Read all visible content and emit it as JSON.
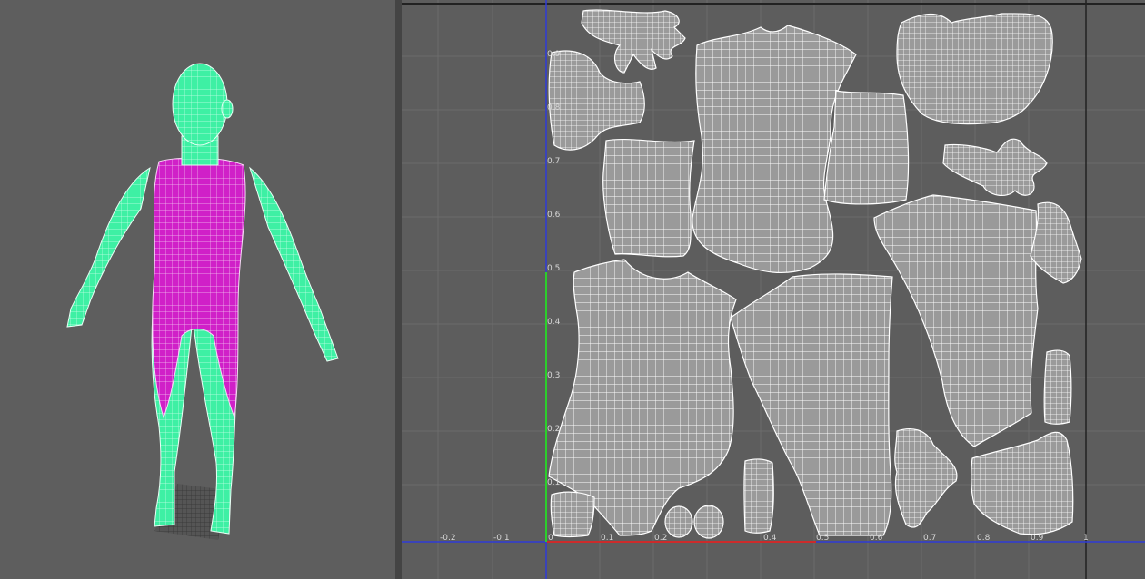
{
  "viewport": {
    "name": "3d-perspective-view",
    "mesh": "female-body-wireframe"
  },
  "uv_editor": {
    "name": "uv-texture-editor",
    "x_ticks": [
      "-0.2",
      "-0.1",
      "0",
      "0.1",
      "0.2",
      "0.4",
      "0.5",
      "0.6",
      "0.7",
      "0.8",
      "0.9",
      "1"
    ],
    "y_ticks": [
      "0.9",
      "0.8",
      "0.7",
      "0.6",
      "0.5",
      "0.4",
      "0.3",
      "0.2",
      "0.1"
    ]
  },
  "colors": {
    "bg": "#5d5d5d",
    "grid": "#6b6b6b",
    "uv_wire": "#ffffff",
    "uv_fill": "#9a9a9a",
    "body_magenta": "#d020c8",
    "body_green": "#3ef0a4",
    "axis_blue": "#2e3bd8",
    "axis_red": "#cc2b2b",
    "axis_green": "#2bcf2b"
  }
}
